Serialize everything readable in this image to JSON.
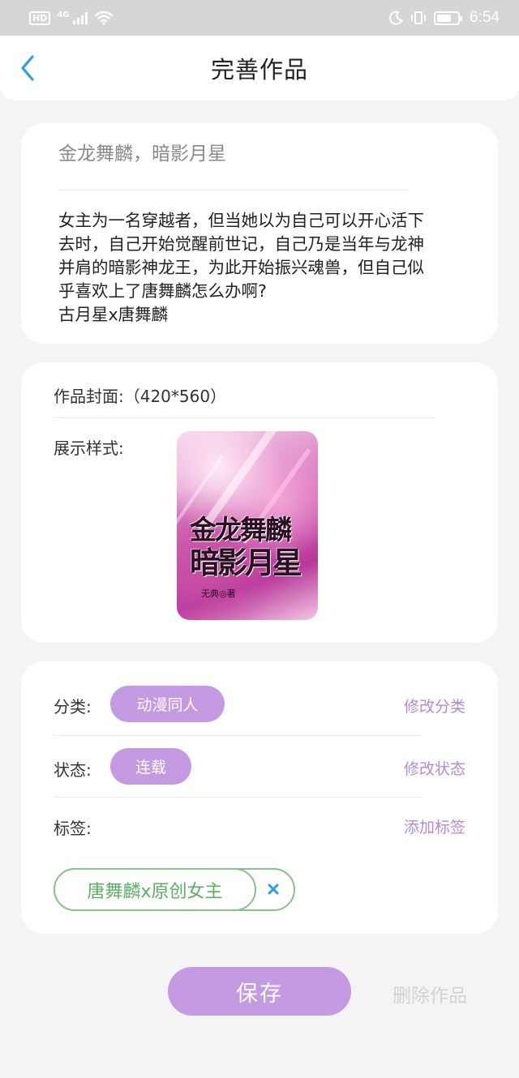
{
  "status_bar": {
    "hd_badge": "HD",
    "network": "4G",
    "time": "6:54",
    "icons": [
      "signal-icon",
      "wifi-icon",
      "moon-icon",
      "vibrate-icon",
      "battery-icon"
    ]
  },
  "header": {
    "title": "完善作品",
    "back_icon": "chevron-left-icon",
    "accent_color": "#2f9de8"
  },
  "work": {
    "title": "金龙舞麟，暗影月星",
    "description_lines": [
      "女主为一名穿越者，但当她以为自己可以开心活下",
      "去时，自己开始觉醒前世记，自己乃是当年与龙神",
      "并肩的暗影神龙王，为此开始振兴魂兽，但自己似",
      "乎喜欢上了唐舞麟怎么办啊?",
      "古月星x唐舞麟"
    ]
  },
  "cover": {
    "label": "作品封面:（420*560）",
    "display_label": "展示样式:",
    "title_line1": "金龙舞麟",
    "title_line2": "暗影月星",
    "author": "无典◎著"
  },
  "meta": {
    "category_label": "分类:",
    "category_value": "动漫同人",
    "category_action": "修改分类",
    "status_label": "状态:",
    "status_value": "连载",
    "status_action": "修改状态",
    "tags_label": "标签:",
    "tags_action": "添加标签",
    "tags": [
      "唐舞麟x原创女主"
    ]
  },
  "actions": {
    "save": "保存",
    "delete": "删除作品"
  },
  "colors": {
    "purple": "#c49ae3",
    "purple_text": "#b48ad6",
    "green_tag": "#86c28a",
    "background": "#f4f4f4"
  }
}
